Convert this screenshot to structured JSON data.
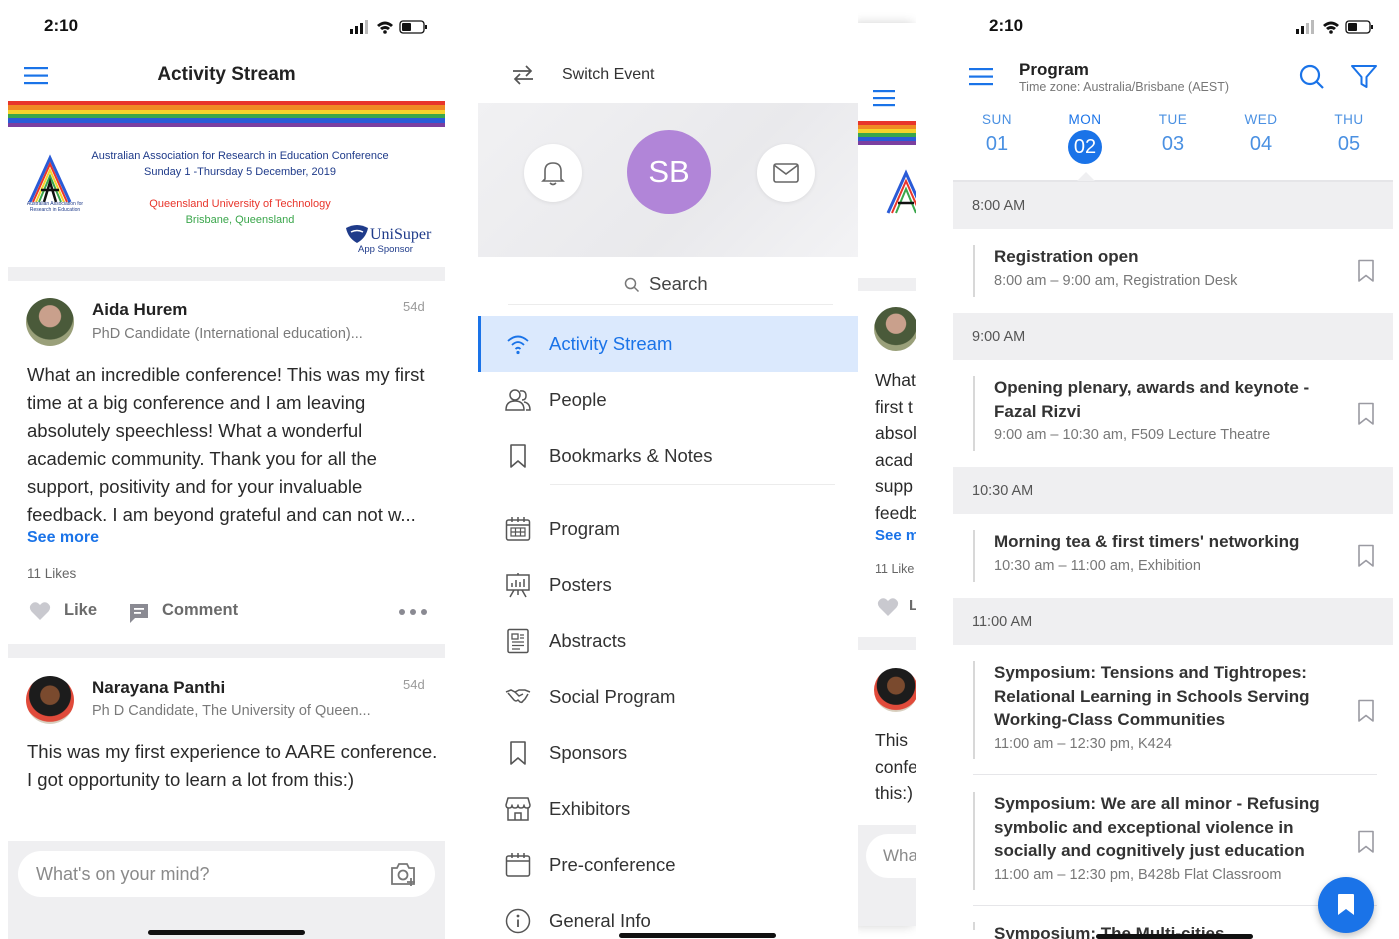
{
  "status": {
    "time": "2:10"
  },
  "screen1": {
    "title": "Activity Stream",
    "rainbow": [
      "#e8352b",
      "#f08a24",
      "#f5d32b",
      "#3aa64b",
      "#2a5bd7",
      "#7b3fa0"
    ],
    "banner": {
      "line1": "Australian Association for Research in Education Conference",
      "line2": "Sunday 1 -Thursday 5 December, 2019",
      "line3": "Queensland University of Technology",
      "line4": "Brisbane, Queensland",
      "logo_caption": "Australian Association for Research in Education",
      "sponsor_name": "UniSuper",
      "sponsor_sub": "App Sponsor"
    },
    "posts": [
      {
        "name": "Aida Hurem",
        "subtitle": "PhD Candidate (International education)...",
        "age": "54d",
        "body": "What an incredible conference! This was my first time at a big conference and I am leaving absolutely speechless! What a wonderful academic community. Thank you for all the support, positivity and for your invaluable feedback. I am beyond grateful and can not w...",
        "see_more": "See more",
        "likes": "11 Likes",
        "like_label": "Like",
        "comment_label": "Comment"
      },
      {
        "name": "Narayana Panthi",
        "subtitle": "Ph D Candidate, The University of Queen...",
        "age": "54d",
        "body": "This was my first experience to AARE conference. I got opportunity to learn a lot from this:)"
      }
    ],
    "composer_placeholder": "What's on your mind?"
  },
  "screen2": {
    "switch_event": "Switch Event",
    "avatar_initials": "SB",
    "search_label": "Search",
    "menu": [
      {
        "label": "Activity Stream",
        "icon": "wifi-icon",
        "active": true
      },
      {
        "label": "People",
        "icon": "people-icon"
      },
      {
        "label": "Bookmarks & Notes",
        "icon": "bookmark-icon"
      },
      {
        "label": "Program",
        "icon": "calendar-grid-icon"
      },
      {
        "label": "Posters",
        "icon": "easel-icon"
      },
      {
        "label": "Abstracts",
        "icon": "document-icon"
      },
      {
        "label": "Social Program",
        "icon": "handshake-icon"
      },
      {
        "label": "Sponsors",
        "icon": "bookmark-icon"
      },
      {
        "label": "Exhibitors",
        "icon": "store-icon"
      },
      {
        "label": "Pre-conference",
        "icon": "calendar-icon"
      },
      {
        "label": "General Info",
        "icon": "info-icon"
      }
    ],
    "peek": {
      "lines": [
        "What",
        "first t",
        "absol",
        "acad",
        "supp",
        "feedb"
      ],
      "see_more": "See m",
      "likes": "11 Like",
      "like": "L",
      "lines2": [
        "This ",
        "confe",
        "this:)"
      ],
      "composer": "Wha"
    }
  },
  "screen4": {
    "title": "Program",
    "timezone": "Time zone: Australia/Brisbane (AEST)",
    "accent": "#1a73e8",
    "days": [
      {
        "name": "SUN",
        "date": "01"
      },
      {
        "name": "MON",
        "date": "02",
        "selected": true
      },
      {
        "name": "TUE",
        "date": "03"
      },
      {
        "name": "WED",
        "date": "04"
      },
      {
        "name": "THU",
        "date": "05"
      }
    ],
    "slots": [
      {
        "time": "8:00 AM",
        "sessions": [
          {
            "title": "Registration open",
            "meta": "8:00 am – 9:00 am,  Registration Desk"
          }
        ]
      },
      {
        "time": "9:00 AM",
        "sessions": [
          {
            "title": "Opening plenary, awards and keynote - Fazal Rizvi",
            "meta": "9:00 am – 10:30 am,  F509 Lecture Theatre"
          }
        ]
      },
      {
        "time": "10:30 AM",
        "sessions": [
          {
            "title": "Morning tea & first timers' networking",
            "meta": "10:30 am – 11:00 am,  Exhibition"
          }
        ]
      },
      {
        "time": "11:00 AM",
        "sessions": [
          {
            "title": "Symposium: Tensions and Tightropes: Relational Learning in Schools Serving Working-Class Communities",
            "meta": "11:00 am – 12:30 pm,  K424"
          },
          {
            "title": "Symposium: We are all minor - Refusing symbolic and exceptional violence in socially and cognitively just education",
            "meta": "11:00 am – 12:30 pm,  B428b Flat Classroom"
          },
          {
            "title": "Symposium: The Multi-cities"
          }
        ]
      }
    ]
  }
}
